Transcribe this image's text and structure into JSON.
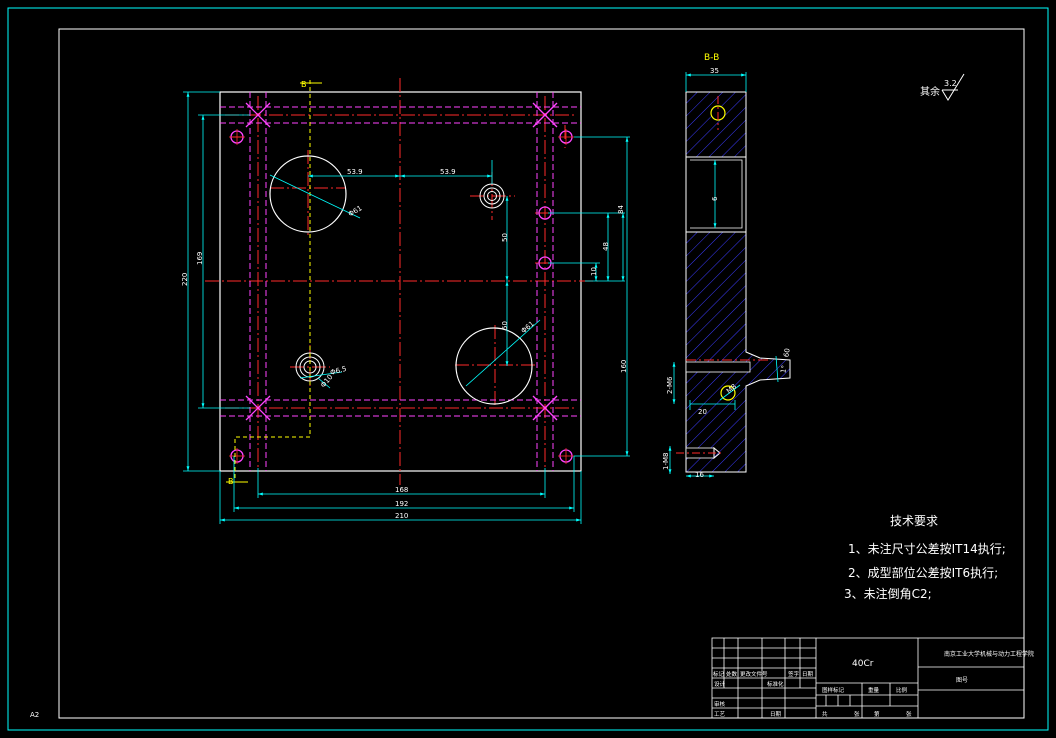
{
  "colors": {
    "background": "#000000",
    "frame": "#00ffff",
    "part": "#ffffff",
    "center_line": "#ff2a2a",
    "hidden_line": "#ff44ff",
    "dimension": "#00ffff",
    "hatch": "#3b3bff",
    "section_mark": "#ffff00",
    "text": "#ffffff"
  },
  "section_label": "B-B",
  "section_marks": {
    "top": "B",
    "bottom": "B"
  },
  "roughness": {
    "prefix": "其余",
    "value": "3.2"
  },
  "dims_front": {
    "d_53_9_a": "53.9",
    "d_53_9_b": "53.9",
    "d_50_a": "50",
    "d_50_b": "50",
    "d_84": "84",
    "d_48": "48",
    "d_10": "10",
    "d_160v": "160",
    "d_220": "220",
    "d_169": "169",
    "d_168": "168",
    "d_192": "192",
    "d_210": "210",
    "phi_big_a": "Φ61",
    "phi_big_b": "Φ61",
    "phi_small_a": "Φ6.5",
    "phi_small_b": "Φ10"
  },
  "dims_section": {
    "d_35": "35",
    "d_6": "6",
    "d_2_m6": "2-M6",
    "d_20": "20",
    "d_M8": "M8",
    "d_1_M8": "1-M8",
    "d_16": "16",
    "d_angle": "1°",
    "d_60": "60"
  },
  "tech": {
    "title": "技术要求",
    "items": [
      "1、未注尺寸公差按IT14执行;",
      "2、成型部位公差按IT6执行;",
      "3、未注倒角C2;"
    ]
  },
  "title_block": {
    "material": "40Cr",
    "school": "南京工业大学机械与动力工程学院",
    "drawing_no": "图号",
    "h_biaoji": "标记",
    "h_chushu": "处数",
    "h_wenjian": "更改文件号",
    "h_qianzi": "签字",
    "h_riqi": "日期",
    "h_sheji": "设计",
    "h_biaozhun": "标准化",
    "h_shenhe": "审核",
    "h_gongyi": "工艺",
    "h_riqi2": "日期",
    "h_tuyang": "图样标记",
    "h_zhongliang": "重量",
    "h_bili": "比例",
    "h_gong": "共",
    "h_zhang": "张",
    "h_di": "第",
    "h_zhang2": "张"
  },
  "sheet_size": "A2"
}
